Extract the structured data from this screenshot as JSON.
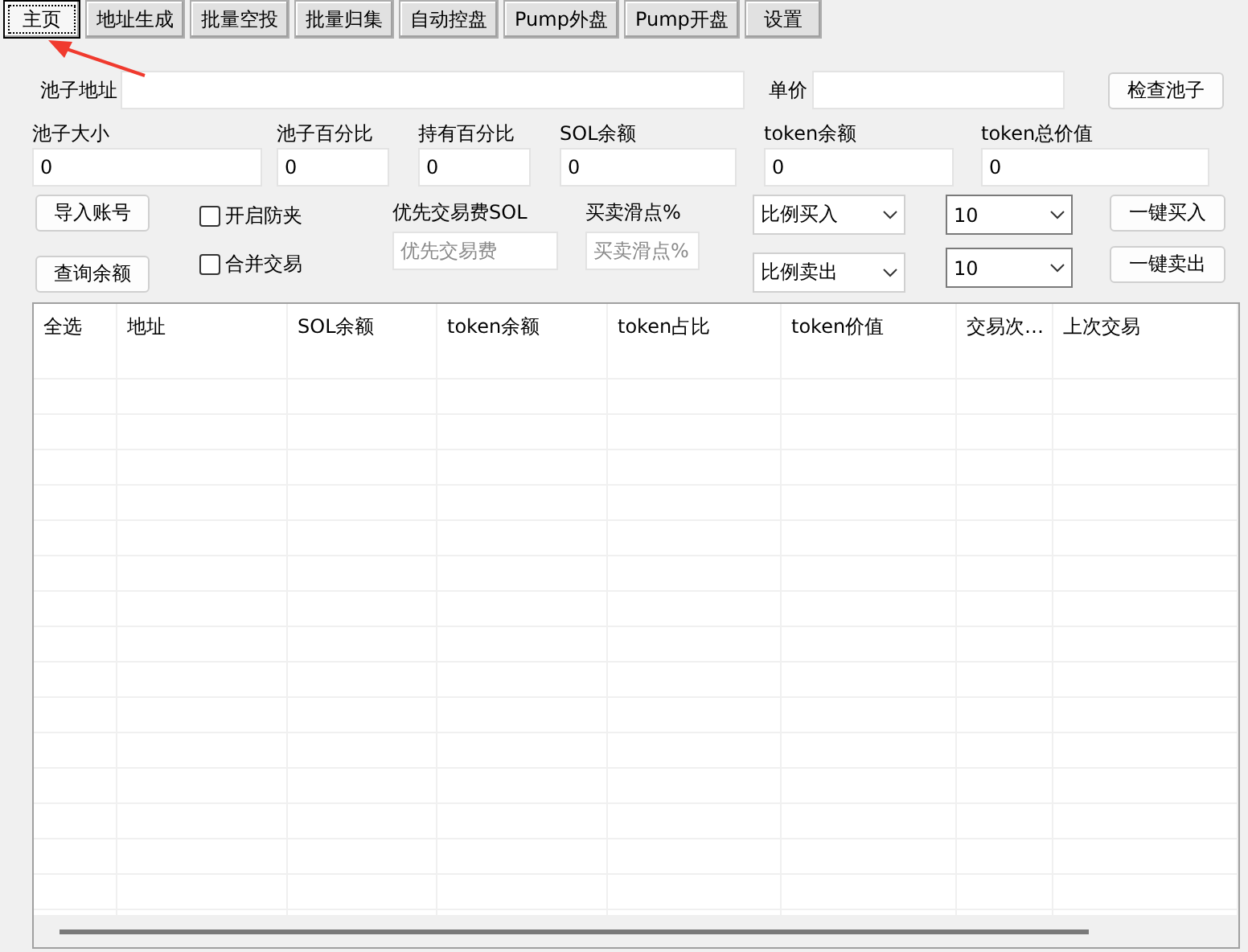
{
  "tabs": [
    {
      "label": "主页",
      "selected": true
    },
    {
      "label": "地址生成",
      "selected": false
    },
    {
      "label": "批量空投",
      "selected": false
    },
    {
      "label": "批量归集",
      "selected": false
    },
    {
      "label": "自动控盘",
      "selected": false
    },
    {
      "label": "Pump外盘",
      "selected": false
    },
    {
      "label": "Pump开盘",
      "selected": false
    },
    {
      "label": "设置",
      "selected": false
    }
  ],
  "pool": {
    "address_label": "池子地址",
    "price_label": "单价",
    "check_button": "检查池子"
  },
  "stats": [
    {
      "label": "池子大小",
      "value": "0"
    },
    {
      "label": "池子百分比",
      "value": "0"
    },
    {
      "label": "持有百分比",
      "value": "0"
    },
    {
      "label": "SOL余额",
      "value": "0"
    },
    {
      "label": "token余额",
      "value": "0"
    },
    {
      "label": "token总价值",
      "value": "0"
    }
  ],
  "account_buttons": [
    "导入账号",
    "查询余额"
  ],
  "checkboxes": [
    {
      "label": "开启防夹",
      "checked": false
    },
    {
      "label": "合并交易",
      "checked": false
    }
  ],
  "priority_fee": {
    "label": "优先交易费SOL",
    "placeholder": "优先交易费"
  },
  "slippage": {
    "label": "买卖滑点%",
    "placeholder": "买卖滑点%"
  },
  "mode_dropdowns": [
    "比例买入",
    "比例卖出"
  ],
  "amount_dropdowns": [
    "10",
    "10"
  ],
  "action_buttons": [
    "一键买入",
    "一键卖出"
  ],
  "table": {
    "columns": [
      "全选",
      "地址",
      "SOL余额",
      "token余额",
      "token占比",
      "token价值",
      "交易次…",
      "上次交易"
    ]
  }
}
